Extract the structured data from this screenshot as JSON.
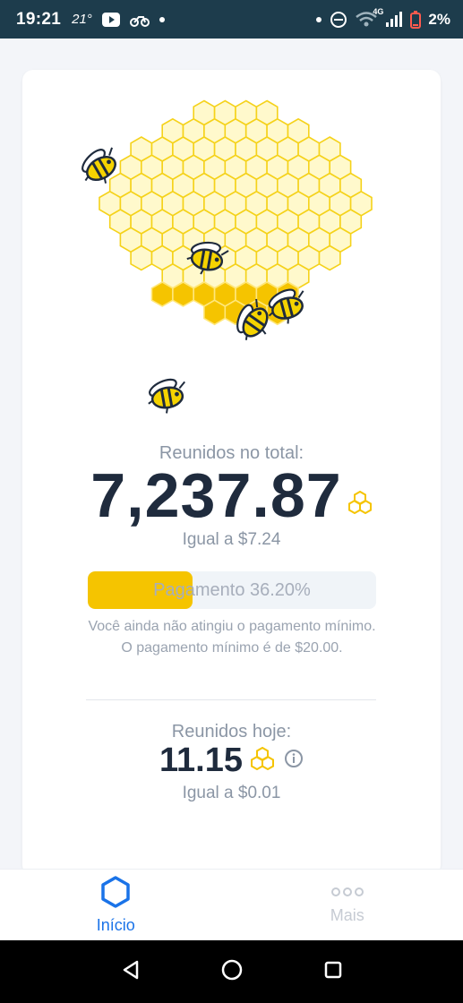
{
  "status_bar": {
    "time": "19:21",
    "temperature": "21°",
    "battery": "2%",
    "network": "4G"
  },
  "hive": {
    "bee_count": 5,
    "colors": {
      "hex_fill": "#fff9cc",
      "hex_stroke": "#f5d21a",
      "honey": "#f5c400",
      "bee_body": "#f5d300",
      "bee_stripe": "#1f2b3d"
    }
  },
  "totals": {
    "label": "Reunidos no total:",
    "value": "7,237.87",
    "equal": "Igual a $7.24"
  },
  "payment": {
    "label": "Pagamento 36.20%",
    "progress_fraction": 0.362,
    "notice": "Você ainda não atingiu o pagamento mínimo. O pagamento mínimo é de $20.00."
  },
  "today": {
    "label": "Reunidos hoje:",
    "value": "11.15",
    "equal": "Igual a $0.01"
  },
  "bottom_nav": {
    "items": [
      {
        "label": "Início",
        "icon": "hexagon-icon",
        "active": true
      },
      {
        "label": "Mais",
        "icon": "more-dots-icon",
        "active": false
      }
    ]
  },
  "colors": {
    "accent": "#1a73e8",
    "status_bar": "#1d3c4c",
    "text_dark": "#1f2b3d",
    "text_muted": "#8b96a5",
    "progress_fill": "#f5c400"
  }
}
